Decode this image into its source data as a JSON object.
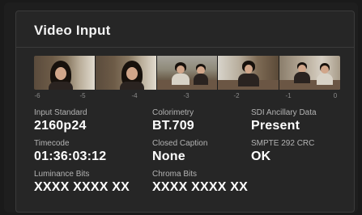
{
  "panel": {
    "title": "Video Input"
  },
  "timeline": {
    "ticks": [
      "-6",
      "-5",
      "-4",
      "-3",
      "-2",
      "-1",
      "0"
    ]
  },
  "fields": {
    "input_standard": {
      "label": "Input Standard",
      "value": "2160p24"
    },
    "colorimetry": {
      "label": "Colorimetry",
      "value": "BT.709"
    },
    "sdi_ancillary": {
      "label": "SDI Ancillary Data",
      "value": "Present"
    },
    "timecode": {
      "label": "Timecode",
      "value": "01:36:03:12"
    },
    "closed_caption": {
      "label": "Closed Caption",
      "value": "None"
    },
    "smpte_crc": {
      "label": "SMPTE 292 CRC",
      "value": "OK"
    },
    "luminance_bits": {
      "label": "Luminance Bits",
      "value": "XXXX XXXX XX"
    },
    "chroma_bits": {
      "label": "Chroma Bits",
      "value": "XXXX XXXX XX"
    }
  }
}
